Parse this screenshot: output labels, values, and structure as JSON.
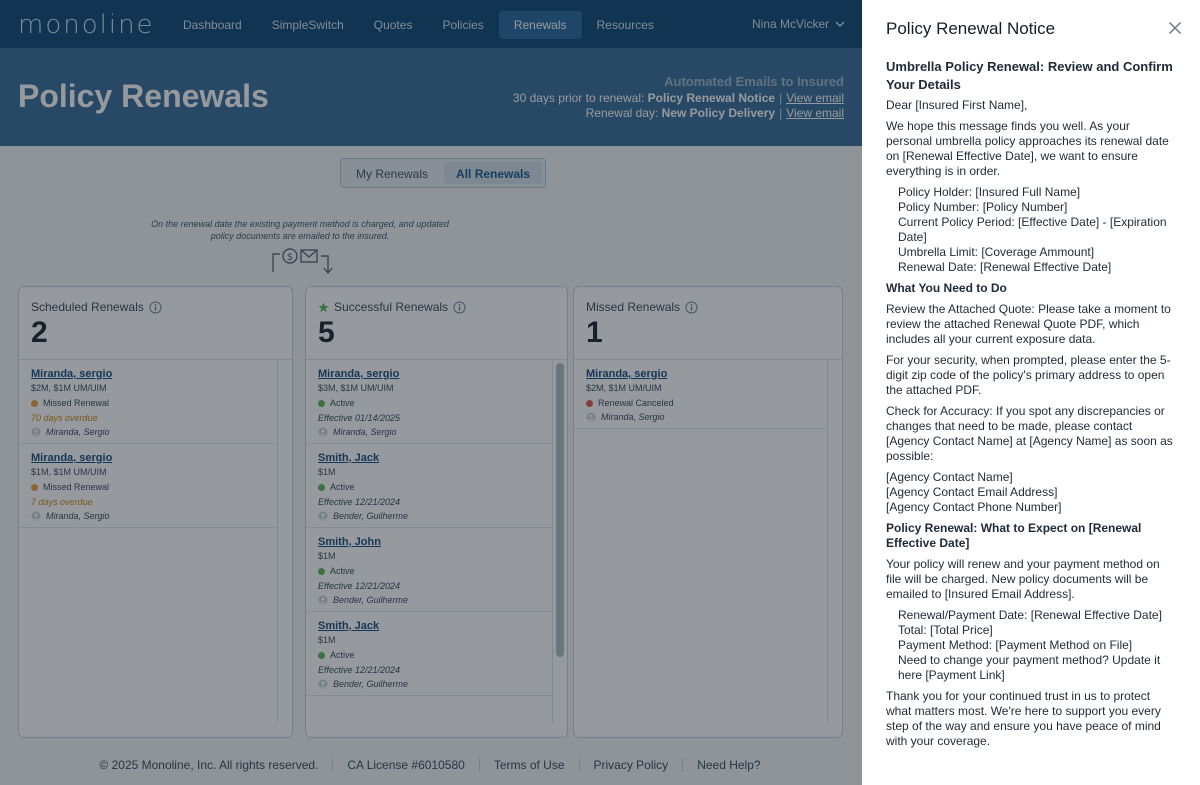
{
  "app": {
    "logo": "monoline",
    "nav": [
      "Dashboard",
      "SimpleSwitch",
      "Quotes",
      "Policies",
      "Renewals",
      "Resources"
    ],
    "active_nav": "Renewals",
    "user": "Nina McVicker"
  },
  "hero": {
    "title": "Policy Renewals",
    "auto_emails": {
      "heading": "Automated Emails to Insured",
      "row1_prefix": "30 days prior to renewal:",
      "row1_bold": "Policy Renewal Notice",
      "row1_link": "View email",
      "row2_prefix": "Renewal day:",
      "row2_bold": "New Policy Delivery",
      "row2_link": "View email"
    }
  },
  "toggle": {
    "options": [
      "My Renewals",
      "All Renewals"
    ],
    "active": "All Renewals"
  },
  "process_note": "On the renewal date the existing payment method is charged, and updated policy documents are emailed to the insured.",
  "columns": [
    {
      "title": "Scheduled Renewals",
      "count": "2",
      "cards": [
        {
          "name": "Miranda, sergio",
          "limits": "$2M, $1M UM/UIM",
          "status": "Missed Renewal",
          "status_color": "#e8a23a",
          "note": "70 days overdue",
          "note_color": "#c98a14",
          "agent": "Miranda, Sergio"
        },
        {
          "name": "Miranda, sergio",
          "limits": "$1M, $1M UM/UIM",
          "status": "Missed Renewal",
          "status_color": "#e8a23a",
          "note": "7 days overdue",
          "note_color": "#c98a14",
          "agent": "Miranda, Sergio"
        }
      ]
    },
    {
      "title": "Successful Renewals",
      "count": "5",
      "cards": [
        {
          "name": "Miranda, sergio",
          "limits": "$3M, $1M UM/UIM",
          "status": "Active",
          "status_color": "#5cb85c",
          "note": "Effective 01/14/2025",
          "note_color": "#3b4b5c",
          "agent": "Miranda, Sergio"
        },
        {
          "name": "Smith, Jack",
          "limits": "$1M",
          "status": "Active",
          "status_color": "#5cb85c",
          "note": "Effective 12/21/2024",
          "note_color": "#3b4b5c",
          "agent": "Bender, Guilherme"
        },
        {
          "name": "Smith, John",
          "limits": "$1M",
          "status": "Active",
          "status_color": "#5cb85c",
          "note": "Effective 12/21/2024",
          "note_color": "#3b4b5c",
          "agent": "Bender, Guilherme"
        },
        {
          "name": "Smith, Jack",
          "limits": "$1M",
          "status": "Active",
          "status_color": "#5cb85c",
          "note": "Effective 12/21/2024",
          "note_color": "#3b4b5c",
          "agent": "Bender, Guilherme"
        }
      ]
    },
    {
      "title": "Missed Renewals",
      "count": "1",
      "cards": [
        {
          "name": "Miranda, sergio",
          "limits": "$2M, $1M UM/UIM",
          "status": "Renewal Canceled",
          "status_color": "#e05a4f",
          "note": "",
          "note_color": "#3b4b5c",
          "agent": "Miranda, Sergio"
        }
      ]
    }
  ],
  "footer": {
    "copyright": "© 2025 Monoline, Inc. All rights reserved.",
    "license": "CA License #6010580",
    "terms": "Terms of Use",
    "privacy": "Privacy Policy",
    "help": "Need Help?"
  },
  "panel": {
    "title": "Policy Renewal Notice",
    "subject": "Umbrella Policy Renewal: Review and Confirm Your Details",
    "greeting": "Dear [Insured First Name],",
    "intro": "We hope this message finds you well. As your personal umbrella policy approaches its renewal date on [Renewal Effective Date], we want to ensure everything is in order.",
    "details": [
      "Policy Holder: [Insured Full Name]",
      "Policy Number: [Policy Number]",
      "Current Policy Period: [Effective Date] - [Expiration Date]",
      "Umbrella Limit: [Coverage Ammount]",
      "Renewal Date: [Renewal Effective Date]"
    ],
    "todo_heading": "What You Need to Do",
    "todo_review": "Review the Attached Quote: Please take a moment to review the attached Renewal Quote PDF, which includes all your current exposure data.",
    "todo_security": "For your security, when prompted, please enter the 5-digit zip code of the policy's primary address to open the attached PDF.",
    "todo_accuracy": "Check for Accuracy: If you spot any discrepancies or changes that need to be made, please contact [Agency Contact Name] at [Agency Name] as soon as possible:",
    "contact_lines": [
      "[Agency Contact Name]",
      "[Agency Contact Email Address]",
      "[Agency Contact Phone Number]"
    ],
    "expect_heading": "Policy Renewal: What to Expect on [Renewal Effective Date]",
    "expect_text": "Your policy will renew and your payment method on file will be charged. New policy documents will be emailed to [Insured Email Address].",
    "payment_details": [
      "Renewal/Payment Date: [Renewal Effective Date]",
      "Total: [Total Price]",
      "Payment Method: [Payment Method on File]",
      "Need to change your payment method? Update it here [Payment Link]"
    ],
    "closing": "Thank you for your continued trust in us to protect what matters most. We're here to support you every step of the way and ensure you have peace of mind with your coverage."
  }
}
